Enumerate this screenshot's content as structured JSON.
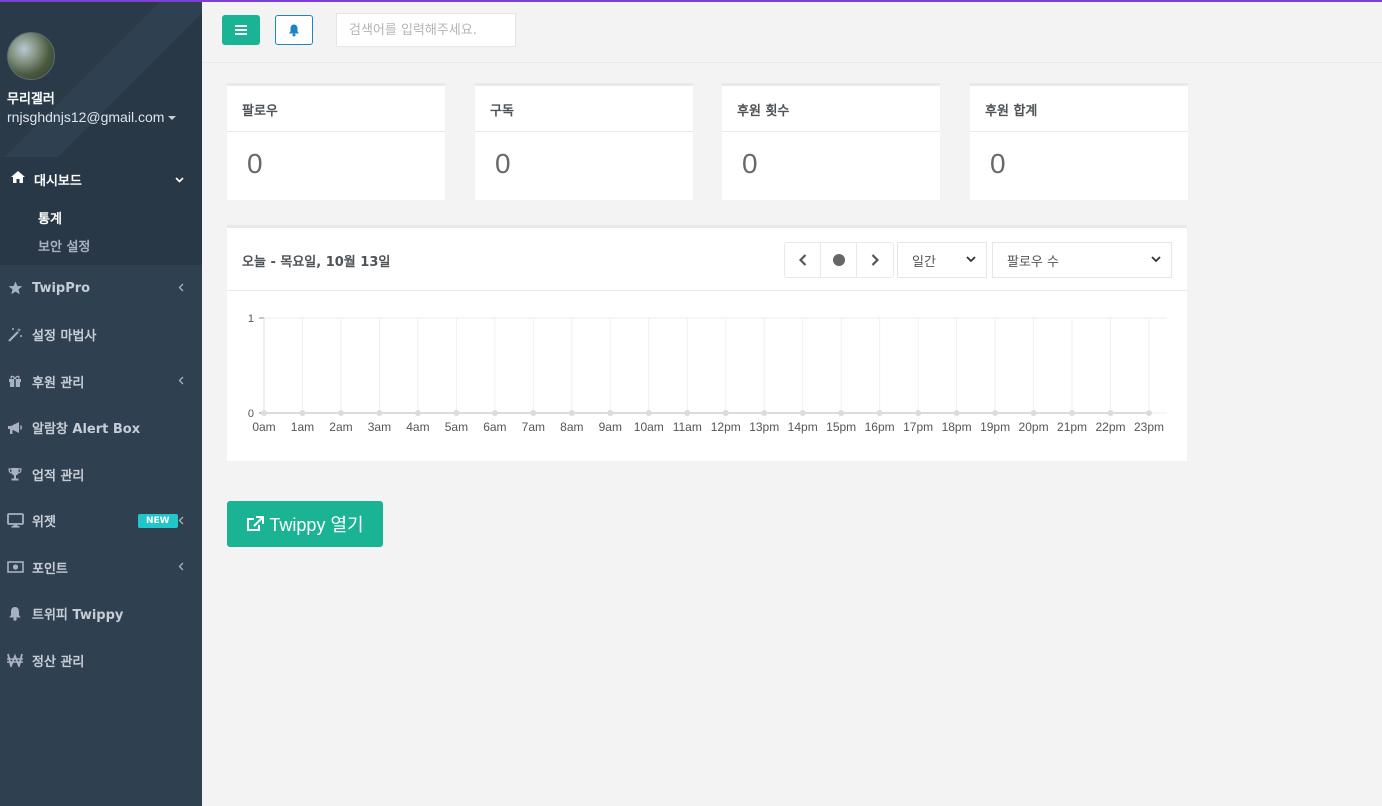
{
  "sidebar": {
    "profile": {
      "name": "무리겔러",
      "email": "rnjsghdnjs12@gmail.com"
    },
    "dashboard": {
      "label": "대시보드",
      "sub_items": [
        "통계",
        "보안 설정"
      ]
    },
    "items": [
      {
        "label": "TwipPro",
        "icon": "star-icon",
        "has_chevron": true
      },
      {
        "label": "설정 마법사",
        "icon": "magic-wand-icon",
        "has_chevron": false
      },
      {
        "label": "후원 관리",
        "icon": "gift-icon",
        "has_chevron": true
      },
      {
        "label": "알람창 Alert Box",
        "icon": "bullhorn-icon",
        "has_chevron": false
      },
      {
        "label": "업적 관리",
        "icon": "trophy-icon",
        "has_chevron": false
      },
      {
        "label": "위젯",
        "icon": "monitor-icon",
        "has_chevron": true,
        "badge": "NEW"
      },
      {
        "label": "포인트",
        "icon": "money-icon",
        "has_chevron": true
      },
      {
        "label": "트위피 Twippy",
        "icon": "bell-icon",
        "has_chevron": false
      },
      {
        "label": "정산 관리",
        "icon": "won-icon",
        "has_chevron": false
      }
    ]
  },
  "topbar": {
    "search_placeholder": "검색어를 입력해주세요."
  },
  "stats": [
    {
      "label": "팔로우",
      "value": "0"
    },
    {
      "label": "구독",
      "value": "0"
    },
    {
      "label": "후원 횟수",
      "value": "0"
    },
    {
      "label": "후원 합계",
      "value": "0"
    }
  ],
  "chart_panel": {
    "title": "오늘 - 목요일, 10월 13일",
    "period_select": "일간",
    "metric_select": "팔로우 수"
  },
  "chart_data": {
    "type": "line",
    "categories": [
      "0am",
      "1am",
      "2am",
      "3am",
      "4am",
      "5am",
      "6am",
      "7am",
      "8am",
      "9am",
      "10am",
      "11am",
      "12pm",
      "13pm",
      "14pm",
      "15pm",
      "16pm",
      "17pm",
      "18pm",
      "19pm",
      "20pm",
      "21pm",
      "22pm",
      "23pm"
    ],
    "series": [
      {
        "values": [
          0,
          0,
          0,
          0,
          0,
          0,
          0,
          0,
          0,
          0,
          0,
          0,
          0,
          0,
          0,
          0,
          0,
          0,
          0,
          0,
          0,
          0,
          0,
          0
        ]
      }
    ],
    "ylim": [
      0,
      1
    ],
    "yticks": [
      "0",
      "1"
    ],
    "grid": true,
    "color": "#dcdcdc"
  },
  "open_button": {
    "label": "Twippy 열기"
  },
  "colors": {
    "primary": "#1ab394",
    "sidebar": "#2f4050",
    "badge": "#23c6c8",
    "bell_border": "#1c84c6"
  }
}
